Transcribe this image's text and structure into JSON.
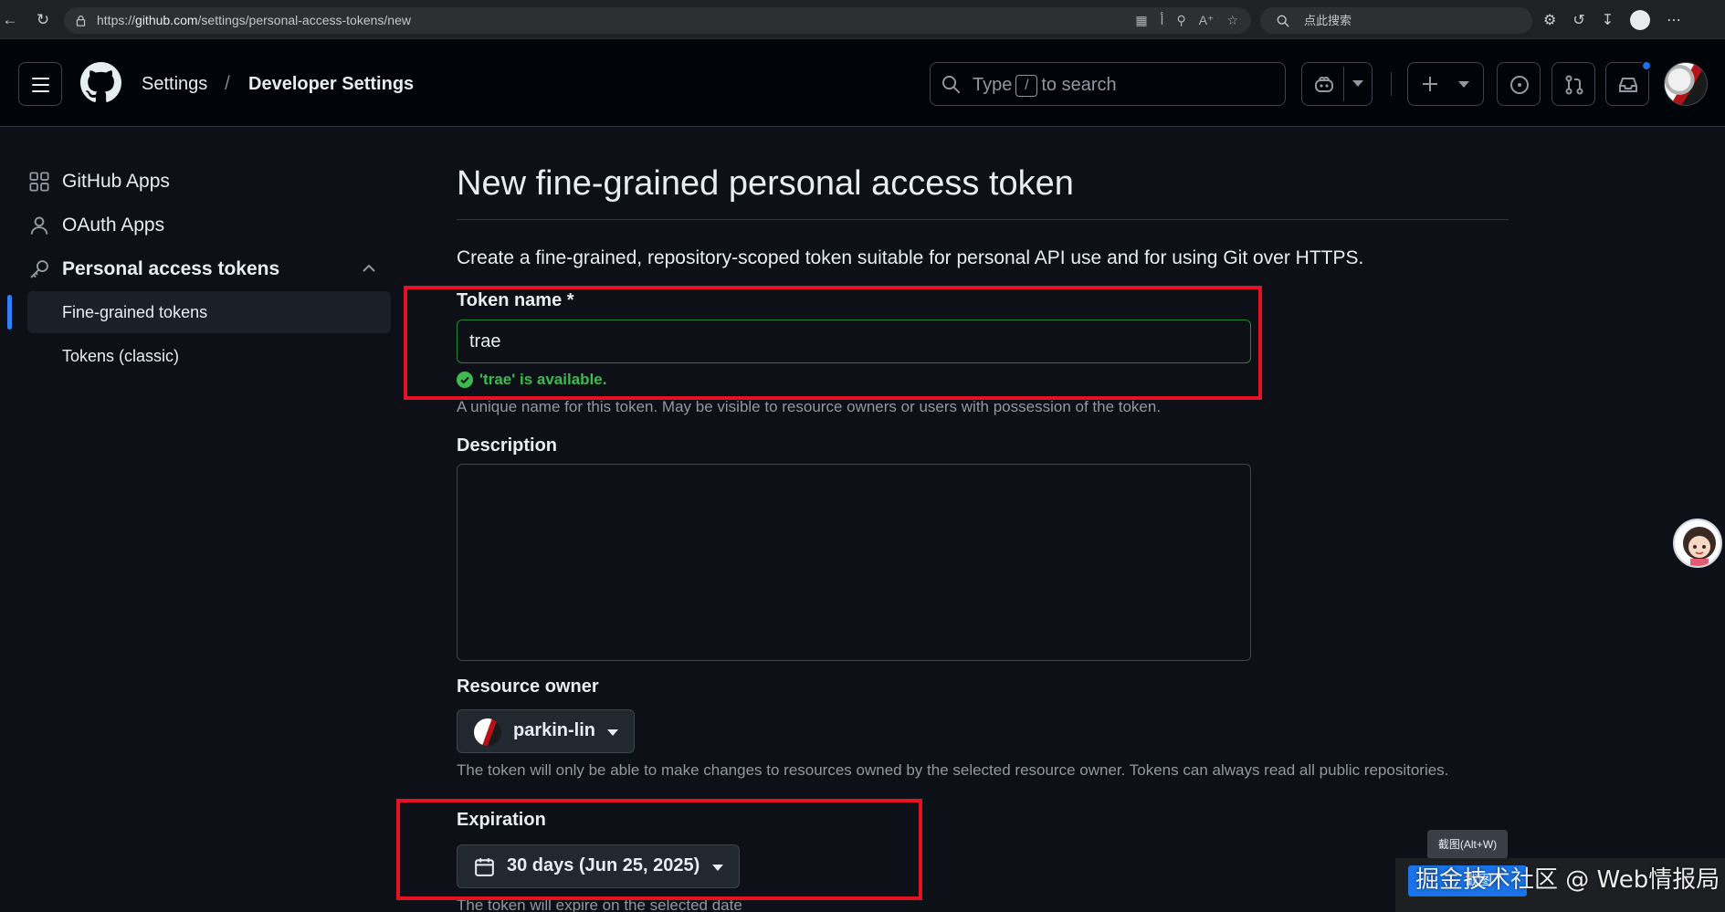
{
  "browser": {
    "url_prefix": "https://",
    "url_host": "github.com",
    "url_path": "/settings/personal-access-tokens/new",
    "search_placeholder": "点此搜索"
  },
  "header": {
    "breadcrumb_settings": "Settings",
    "breadcrumb_separator": "/",
    "breadcrumb_developer": "Developer Settings",
    "search_type": "Type",
    "search_key": "/",
    "search_rest": "to search"
  },
  "sidebar": {
    "items": [
      {
        "label": "GitHub Apps",
        "icon": "apps-grid-icon"
      },
      {
        "label": "OAuth Apps",
        "icon": "person-icon"
      },
      {
        "label": "Personal access tokens",
        "icon": "key-icon"
      }
    ],
    "sub_items": [
      {
        "label": "Fine-grained tokens",
        "active": true
      },
      {
        "label": "Tokens (classic)",
        "active": false
      }
    ]
  },
  "form": {
    "title": "New fine-grained personal access token",
    "description": "Create a fine-grained, repository-scoped token suitable for personal API use and for using Git over HTTPS.",
    "token_name_label": "Token name *",
    "token_name_value": "trae",
    "token_name_status": "'trae' is available.",
    "token_name_hint": "A unique name for this token. May be visible to resource owners or users with possession of the token.",
    "description_label": "Description",
    "description_value": "",
    "resource_owner_label": "Resource owner",
    "resource_owner_value": "parkin-lin",
    "resource_owner_hint": "The token will only be able to make changes to resources owned by the selected resource owner. Tokens can always read all public repositories.",
    "expiration_label": "Expiration",
    "expiration_value": "30 days (Jun 25, 2025)",
    "expiration_hint": "The token will expire on the selected date"
  },
  "overlay": {
    "tooltip": "截图(Alt+W)",
    "screenshot_button": "截图",
    "watermark": "掘金技术社区 @ Web情报局"
  },
  "colors": {
    "accent_blue": "#2f81f7",
    "success_green": "#3fb950",
    "highlight_red": "#e5131f"
  }
}
